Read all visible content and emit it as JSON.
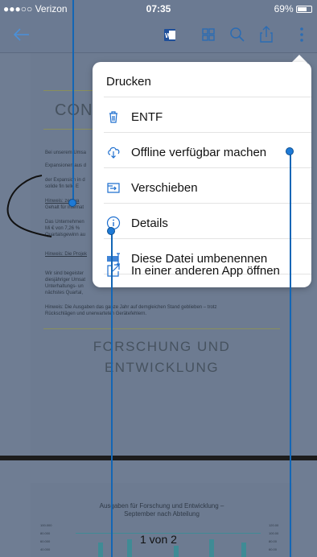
{
  "status_bar": {
    "carrier": "●●●○○ Verizon",
    "time": "07:35",
    "battery": "69%"
  },
  "toolbar": {
    "icons": [
      "back-arrow-icon",
      "word-icon",
      "grid-icon",
      "search-icon",
      "share-icon",
      "more-icon"
    ]
  },
  "document": {
    "title_fragment": "CON",
    "lines": [
      "Bei unserem Umsa",
      "Expansionen aus d",
      "der Expansion in d",
      "solide fin      telle E",
      "Hinweis:   zentua",
      "Gehalt für internat",
      "Das Unternehmen",
      "Mi     € von 7,26 %",
      "Quartalsgewinn au",
      "Hinweis: Die Projek",
      "Wir sind begeister",
      "diesjähriger Umsat",
      "Unterhaltungs- un",
      "nächstes Quartal,",
      "Hinweis: Die Ausgaben                 das ganze Jahr auf demgleichen Stand geblieben – trotz",
      "Rückschlägen und unerwarteten Gerätefehlern."
    ],
    "heading_line1": "FORSCHUNG UND",
    "heading_line2": "ENTWICKLUNG",
    "chart_title_line1": "Ausgaben für Forschung und Entwicklung –",
    "chart_title_line2": "September nach Abteilung",
    "left_ticks": [
      "100.000",
      "80.000",
      "60.000",
      "40.000"
    ],
    "right_ticks": [
      "120.00",
      "100.00",
      "80.00",
      "60.00"
    ],
    "page_indicator": "1 von 2"
  },
  "menu": {
    "items": [
      {
        "label": "Drucken",
        "icon": ""
      },
      {
        "label": "ENTF",
        "icon": "trash-icon"
      },
      {
        "label": "Offline verfügbar machen",
        "icon": "cloud-download-icon"
      },
      {
        "label": "Verschieben",
        "icon": "move-icon"
      },
      {
        "label": "Details",
        "icon": "info-icon"
      },
      {
        "label": "Diese Datei umbenennen",
        "icon": "rename-icon"
      },
      {
        "label": "In einer anderen App öffnen",
        "icon": "open-in-app-icon"
      }
    ]
  },
  "colors": {
    "accent_blue": "#1e7ad6",
    "overlay": "#6b7a92",
    "menu_bg": "#ffffff"
  }
}
